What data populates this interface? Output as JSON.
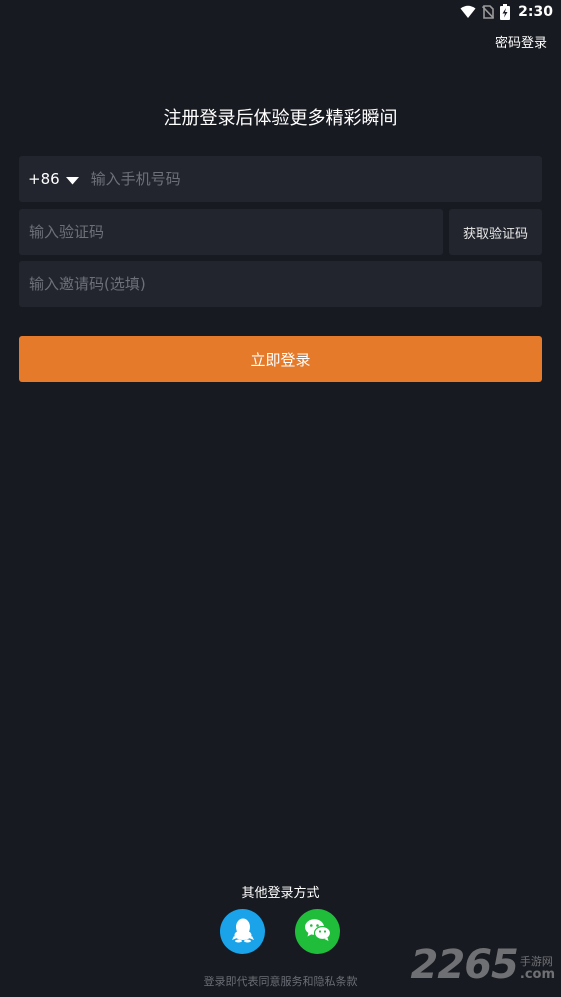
{
  "status_bar": {
    "time": "2:30",
    "icons": [
      "wifi-icon",
      "no-sim-icon",
      "battery-charging-icon"
    ]
  },
  "header": {
    "password_login": "密码登录"
  },
  "title": "注册登录后体验更多精彩瞬间",
  "form": {
    "country_code": "+86",
    "phone_placeholder": "输入手机号码",
    "code_placeholder": "输入验证码",
    "get_code_label": "获取验证码",
    "invite_placeholder": "输入邀请码(选填)",
    "login_label": "立即登录"
  },
  "other_login": {
    "title": "其他登录方式",
    "methods": [
      "qq-icon",
      "wechat-icon"
    ]
  },
  "terms": "登录即代表同意服务和隐私条款",
  "watermark": {
    "number": "2265",
    "cn": "手游网",
    "com": ".com"
  },
  "colors": {
    "background": "#181a21",
    "field": "#22252d",
    "accent": "#e57b2a",
    "qq": "#1aa3e8",
    "wechat": "#1fbd3a"
  }
}
